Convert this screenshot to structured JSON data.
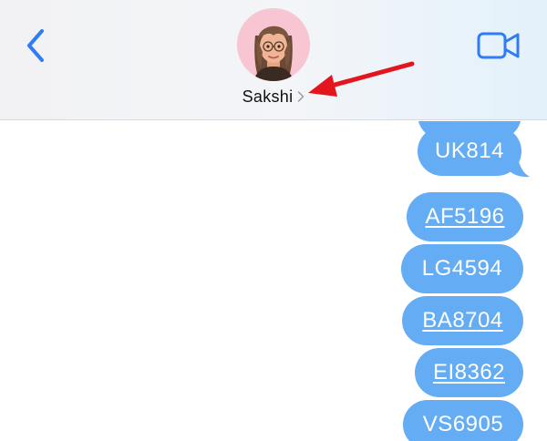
{
  "header": {
    "contact_name": "Sakshi",
    "back_icon": "chevron-left-icon",
    "video_icon": "video-camera-icon",
    "accent_color": "#2f7cf6",
    "annotation_color": "#e3161e"
  },
  "messages": [
    {
      "text": "UK814",
      "link": false
    },
    {
      "text": "AF5196",
      "link": true
    },
    {
      "text": "LG4594",
      "link": false
    },
    {
      "text": "BA8704",
      "link": true
    },
    {
      "text": "EI8362",
      "link": true
    },
    {
      "text": "VS6905",
      "link": false
    }
  ],
  "bubble_color": "#64acf4"
}
